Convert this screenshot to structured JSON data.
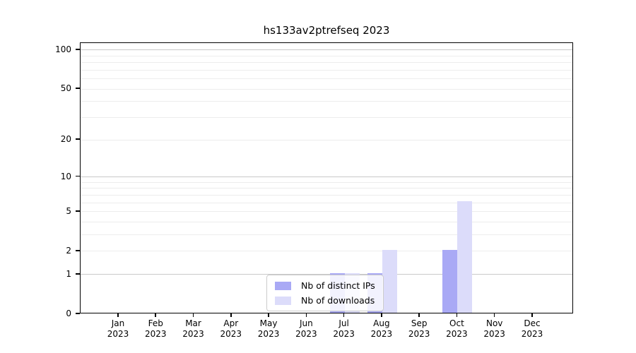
{
  "chart_data": {
    "type": "bar",
    "title": "hs133av2ptrefseq 2023",
    "categories": [
      "Jan 2023",
      "Feb 2023",
      "Mar 2023",
      "Apr 2023",
      "May 2023",
      "Jun 2023",
      "Jul 2023",
      "Aug 2023",
      "Sep 2023",
      "Oct 2023",
      "Nov 2023",
      "Dec 2023"
    ],
    "series": [
      {
        "name": "Nb of distinct IPs",
        "color": "#a9a9f5",
        "values": [
          0,
          0,
          0,
          0,
          0,
          0,
          1,
          1,
          0,
          2,
          0,
          0
        ]
      },
      {
        "name": "Nb of downloads",
        "color": "#dcdcfa",
        "values": [
          0,
          0,
          0,
          0,
          0,
          0,
          1,
          2,
          0,
          6,
          0,
          0
        ]
      }
    ],
    "xlabel": "",
    "ylabel": "",
    "yscale": "log1p",
    "ylim": [
      0,
      113
    ],
    "yticks": [
      0,
      1,
      2,
      5,
      10,
      20,
      50,
      100
    ],
    "gridlines": {
      "major": [
        1,
        10,
        100
      ],
      "minor": [
        2,
        3,
        4,
        5,
        6,
        7,
        8,
        9,
        20,
        30,
        40,
        50,
        60,
        70,
        80,
        90
      ],
      "major_color": "#c9c9c9",
      "minor_color": "#ededed"
    },
    "legend_position": "inside-bottom-center",
    "axis_color": "#000000",
    "background_color": "#ffffff"
  }
}
